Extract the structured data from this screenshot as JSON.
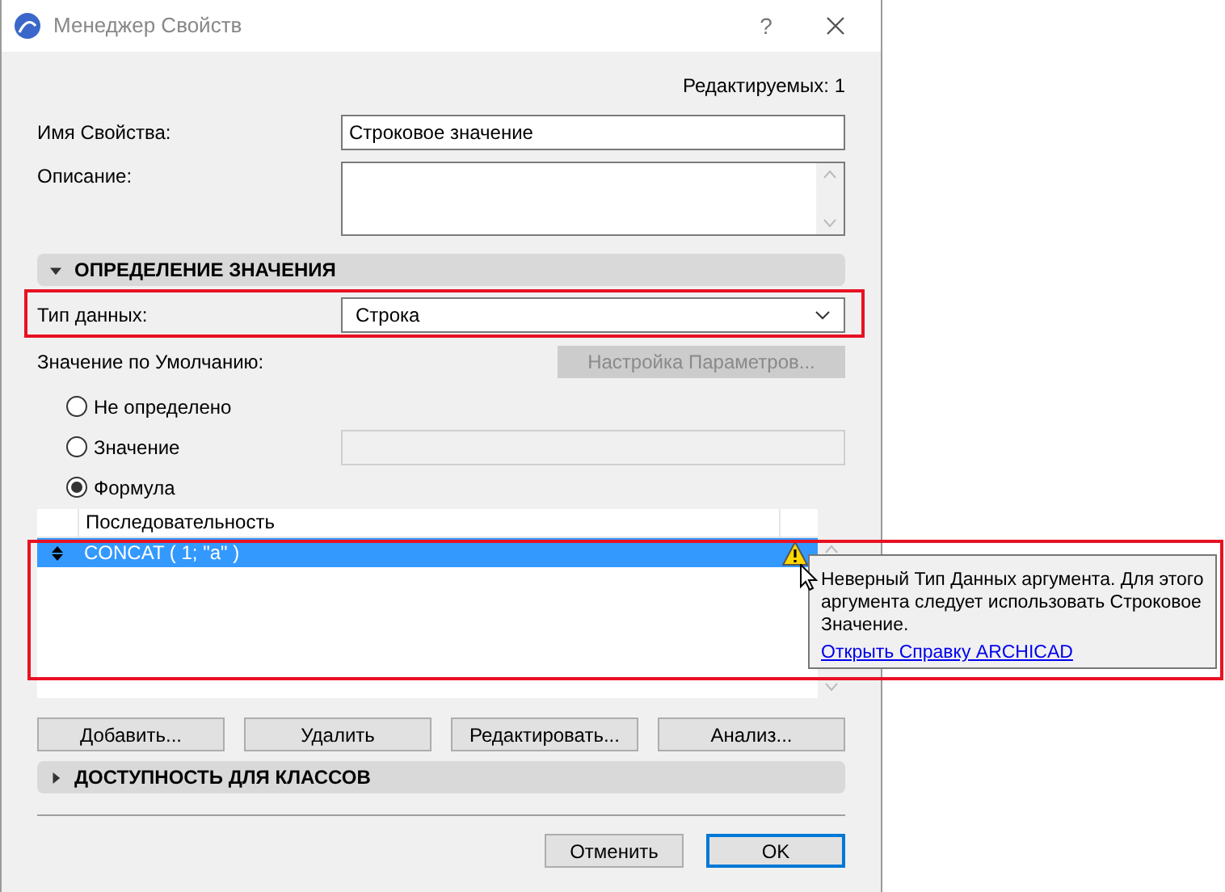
{
  "window": {
    "title": "Менеджер Свойств",
    "help": "?"
  },
  "editable_count": "Редактируемых: 1",
  "name_field": {
    "label": "Имя Свойства:",
    "value": "Строковое значение"
  },
  "description_field": {
    "label": "Описание:"
  },
  "sections": [
    {
      "title": "ОПРЕДЕЛЕНИЕ ЗНАЧЕНИЯ",
      "expanded": true
    },
    {
      "title": "ДОСТУПНОСТЬ ДЛЯ КЛАССОВ",
      "expanded": false
    }
  ],
  "data_type": {
    "label": "Тип данных:",
    "value": "Строка",
    "highlighted": true
  },
  "default_value": {
    "label": "Значение по Умолчанию:",
    "settings_button": {
      "label": "Настройка Параметров...",
      "disabled": true
    }
  },
  "radios": [
    {
      "label": "Не определено",
      "selected": false,
      "kind": "plain"
    },
    {
      "label": "Значение",
      "selected": false,
      "kind": "field"
    },
    {
      "label": "Формула",
      "selected": true,
      "kind": "plain"
    }
  ],
  "table": {
    "columns": [
      "Последовательность"
    ],
    "rows": [
      {
        "text": "CONCAT ( 1; \"a\" )",
        "selected": true,
        "warning": true
      }
    ],
    "highlighted": true
  },
  "tooltip": {
    "text": "Неверный Тип Данных аргумента. Для этого аргумента следует использовать Строковое Значение.",
    "link": "Открыть Справку ARCHICAD"
  },
  "table_buttons": [
    "Добавить...",
    "Удалить",
    "Редактировать...",
    "Анализ..."
  ],
  "footer_buttons": [
    {
      "label": "Отменить",
      "default": false
    },
    {
      "label": "OK",
      "default": true
    }
  ]
}
